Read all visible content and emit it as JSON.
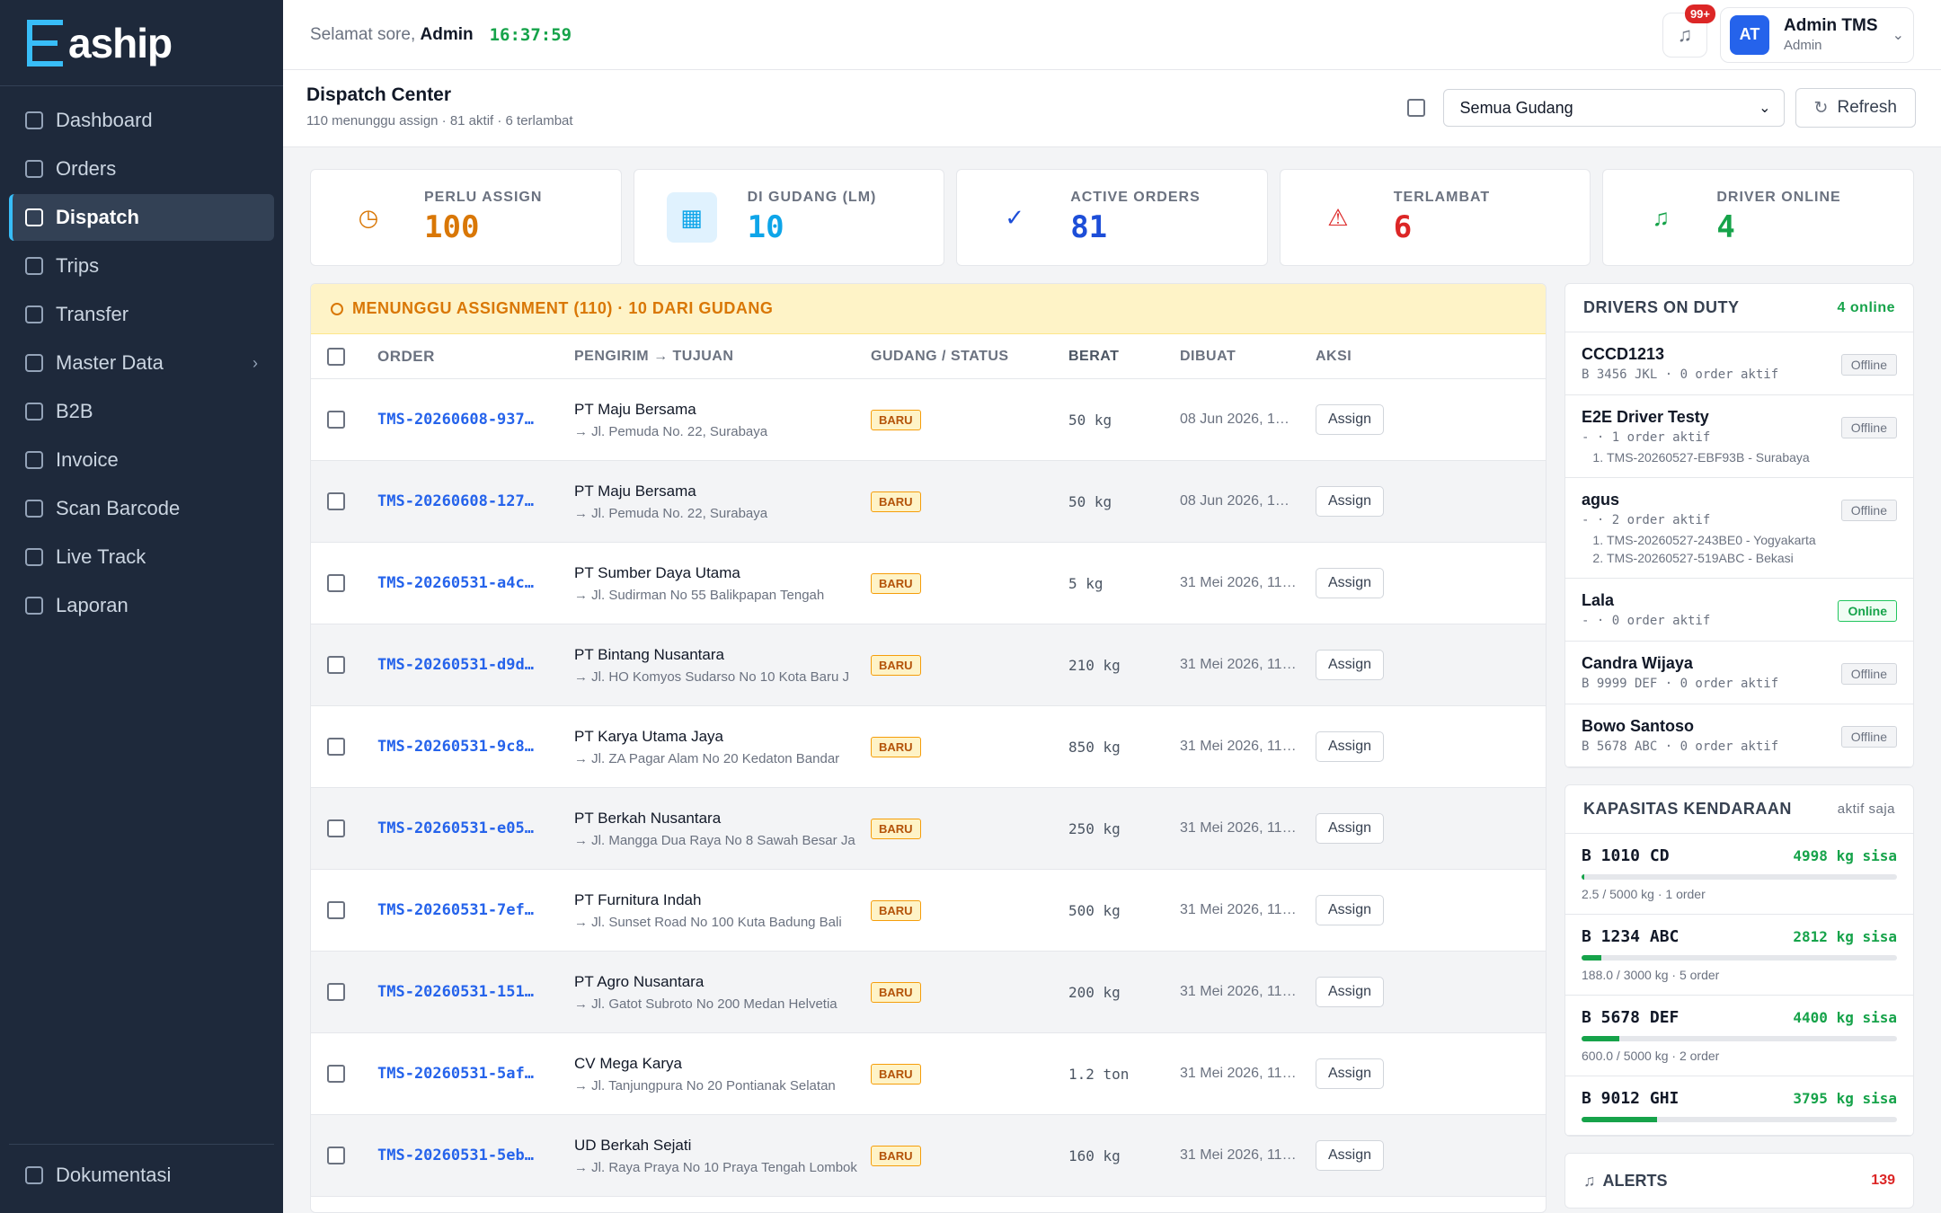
{
  "brand": {
    "name": "aship"
  },
  "sidebar": {
    "items": [
      {
        "label": "Dashboard",
        "icon": "dashboard-icon"
      },
      {
        "label": "Orders",
        "icon": "box-icon"
      },
      {
        "label": "Dispatch",
        "icon": "send-icon",
        "active": true
      },
      {
        "label": "Trips",
        "icon": "route-icon"
      },
      {
        "label": "Transfer",
        "icon": "transfer-icon"
      },
      {
        "label": "Master Data",
        "icon": "database-icon",
        "chevron": "›"
      },
      {
        "label": "B2B",
        "icon": "handshake-icon"
      },
      {
        "label": "Invoice",
        "icon": "invoice-icon"
      },
      {
        "label": "Scan Barcode",
        "icon": "scan-icon"
      },
      {
        "label": "Live Track",
        "icon": "map-pin-icon"
      },
      {
        "label": "Laporan",
        "icon": "report-icon"
      }
    ],
    "bottom": {
      "label": "Dokumentasi",
      "icon": "book-icon"
    }
  },
  "topbar": {
    "greeting_prefix": "Selamat sore, ",
    "greeting_name": "Admin",
    "clock": "16:37:59",
    "notif_badge": "99+",
    "user": {
      "initials": "AT",
      "name": "Admin TMS",
      "role": "Admin"
    }
  },
  "page": {
    "title": "Dispatch Center",
    "subtitle": "110 menunggu assign · 81 aktif · 6 terlambat",
    "warehouse_select": "Semua Gudang",
    "refresh_label": "Refresh"
  },
  "stats": [
    {
      "label": "PERLU ASSIGN",
      "value": "100",
      "color": "#d97706",
      "bg": "#ffffff",
      "icon": "clock-icon",
      "glyph": "◷"
    },
    {
      "label": "DI GUDANG (LM)",
      "value": "10",
      "color": "#0ea5e9",
      "bg": "#e0f2fe",
      "icon": "building-icon",
      "glyph": "▦"
    },
    {
      "label": "ACTIVE ORDERS",
      "value": "81",
      "color": "#1d4ed8",
      "bg": "#ffffff",
      "icon": "check-circle-icon",
      "glyph": "✓"
    },
    {
      "label": "TERLAMBAT",
      "value": "6",
      "color": "#dc2626",
      "bg": "#ffffff",
      "icon": "warning-icon",
      "glyph": "⚠"
    },
    {
      "label": "DRIVER ONLINE",
      "value": "4",
      "color": "#16a34a",
      "bg": "#ffffff",
      "icon": "bell-icon",
      "glyph": "♫"
    }
  ],
  "queue": {
    "title": "MENUNGGU ASSIGNMENT (110) · 10 DARI GUDANG",
    "columns": [
      "ORDER",
      "PENGIRIM → TUJUAN",
      "GUDANG / STATUS",
      "BERAT",
      "DIBUAT",
      "AKSI"
    ],
    "rows": [
      {
        "order": "TMS-20260608-937…",
        "sender": "PT Maju Bersama",
        "dest": "→ Jl. Pemuda No. 22, Surabaya",
        "status": "BARU",
        "weight": "50 kg",
        "created": "08 Jun 2026, 1…",
        "action": "Assign"
      },
      {
        "order": "TMS-20260608-127…",
        "sender": "PT Maju Bersama",
        "dest": "→ Jl. Pemuda No. 22, Surabaya",
        "status": "BARU",
        "weight": "50 kg",
        "created": "08 Jun 2026, 1…",
        "action": "Assign"
      },
      {
        "order": "TMS-20260531-a4c…",
        "sender": "PT Sumber Daya Utama",
        "dest": "→ Jl. Sudirman No 55 Balikpapan Tengah",
        "status": "BARU",
        "weight": "5 kg",
        "created": "31 Mei 2026, 11…",
        "action": "Assign"
      },
      {
        "order": "TMS-20260531-d9d…",
        "sender": "PT Bintang Nusantara",
        "dest": "→ Jl. HO Komyos Sudarso No 10 Kota Baru J",
        "status": "BARU",
        "weight": "210 kg",
        "created": "31 Mei 2026, 11…",
        "action": "Assign"
      },
      {
        "order": "TMS-20260531-9c8…",
        "sender": "PT Karya Utama Jaya",
        "dest": "→ Jl. ZA Pagar Alam No 20 Kedaton Bandar",
        "status": "BARU",
        "weight": "850 kg",
        "created": "31 Mei 2026, 11…",
        "action": "Assign"
      },
      {
        "order": "TMS-20260531-e05…",
        "sender": "PT Berkah Nusantara",
        "dest": "→ Jl. Mangga Dua Raya No 8 Sawah Besar Ja",
        "status": "BARU",
        "weight": "250 kg",
        "created": "31 Mei 2026, 11…",
        "action": "Assign"
      },
      {
        "order": "TMS-20260531-7ef…",
        "sender": "PT Furnitura Indah",
        "dest": "→ Jl. Sunset Road No 100 Kuta Badung Bali",
        "status": "BARU",
        "weight": "500 kg",
        "created": "31 Mei 2026, 11…",
        "action": "Assign"
      },
      {
        "order": "TMS-20260531-151…",
        "sender": "PT Agro Nusantara",
        "dest": "→ Jl. Gatot Subroto No 200 Medan Helvetia",
        "status": "BARU",
        "weight": "200 kg",
        "created": "31 Mei 2026, 11…",
        "action": "Assign"
      },
      {
        "order": "TMS-20260531-5af…",
        "sender": "CV Mega Karya",
        "dest": "→ Jl. Tanjungpura No 20 Pontianak Selatan",
        "status": "BARU",
        "weight": "1.2 ton",
        "created": "31 Mei 2026, 11…",
        "action": "Assign"
      },
      {
        "order": "TMS-20260531-5eb…",
        "sender": "UD Berkah Sejati",
        "dest": "→ Jl. Raya Praya No 10 Praya Tengah Lombok",
        "status": "BARU",
        "weight": "160 kg",
        "created": "31 Mei 2026, 11…",
        "action": "Assign"
      }
    ]
  },
  "drivers": {
    "title": "DRIVERS ON DUTY",
    "count": "4 online",
    "items": [
      {
        "name": "CCCD1213",
        "meta": "B 3456 JKL · 0 order aktif",
        "status": "Offline",
        "orders": []
      },
      {
        "name": "E2E Driver Testy",
        "meta": "- · 1 order aktif",
        "status": "Offline",
        "orders": [
          "TMS-20260527-EBF93B - Surabaya"
        ]
      },
      {
        "name": "agus",
        "meta": "- · 2 order aktif",
        "status": "Offline",
        "orders": [
          "TMS-20260527-243BE0 - Yogyakarta",
          "TMS-20260527-519ABC - Bekasi"
        ]
      },
      {
        "name": "Lala",
        "meta": "- · 0 order aktif",
        "status": "Online",
        "orders": []
      },
      {
        "name": "Candra Wijaya",
        "meta": "B 9999 DEF · 0 order aktif",
        "status": "Offline",
        "orders": []
      },
      {
        "name": "Bowo Santoso",
        "meta": "B 5678 ABC · 0 order aktif",
        "status": "Offline",
        "orders": []
      }
    ]
  },
  "vehicles": {
    "title": "KAPASITAS KENDARAAN",
    "note": "aktif saja",
    "items": [
      {
        "plate": "B 1010 CD",
        "remaining": "4998 kg sisa",
        "detail": "2.5 / 5000 kg · 1 order",
        "load": 0.0005
      },
      {
        "plate": "B 1234 ABC",
        "remaining": "2812 kg sisa",
        "detail": "188.0 / 3000 kg · 5 order",
        "load": 0.063
      },
      {
        "plate": "B 5678 DEF",
        "remaining": "4400 kg sisa",
        "detail": "600.0 / 5000 kg · 2 order",
        "load": 0.12
      },
      {
        "plate": "B 9012 GHI",
        "remaining": "3795 kg sisa",
        "detail": "",
        "load": 0.24
      }
    ]
  },
  "alerts": {
    "title": "ALERTS",
    "count": "139"
  }
}
